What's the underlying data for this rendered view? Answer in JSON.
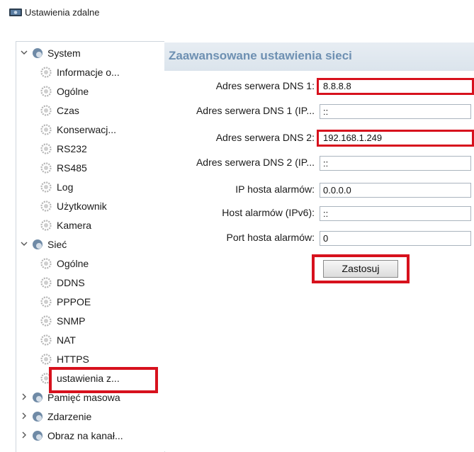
{
  "window": {
    "title": "Ustawienia zdalne",
    "icon": "device-icon"
  },
  "tree": {
    "items": [
      {
        "label": "System",
        "level": 0,
        "expanded": true
      },
      {
        "label": "Informacje o...",
        "level": 1
      },
      {
        "label": "Ogólne",
        "level": 1
      },
      {
        "label": "Czas",
        "level": 1
      },
      {
        "label": "Konserwacj...",
        "level": 1
      },
      {
        "label": "RS232",
        "level": 1
      },
      {
        "label": "RS485",
        "level": 1
      },
      {
        "label": "Log",
        "level": 1
      },
      {
        "label": "Użytkownik",
        "level": 1
      },
      {
        "label": "Kamera",
        "level": 1
      },
      {
        "label": "Sieć",
        "level": 0,
        "expanded": true
      },
      {
        "label": "Ogólne",
        "level": 1
      },
      {
        "label": "DDNS",
        "level": 1
      },
      {
        "label": "PPPOE",
        "level": 1
      },
      {
        "label": "SNMP",
        "level": 1
      },
      {
        "label": "NAT",
        "level": 1
      },
      {
        "label": "HTTPS",
        "level": 1
      },
      {
        "label": "ustawienia z...",
        "level": 1,
        "selected": true
      },
      {
        "label": "Pamięć masowa",
        "level": 0,
        "expanded": false
      },
      {
        "label": "Zdarzenie",
        "level": 0,
        "expanded": false
      },
      {
        "label": "Obraz na kanał...",
        "level": 0,
        "expanded": false
      }
    ]
  },
  "panel": {
    "title": "Zaawansowane ustawienia sieci",
    "fields": [
      {
        "label": "Adres serwera DNS 1:",
        "value": "8.8.8.8",
        "highlighted": true
      },
      {
        "label": "Adres serwera DNS 1 (IP...",
        "value": "::",
        "highlighted": false
      },
      {
        "label": "Adres serwera DNS 2:",
        "value": "192.168.1.249",
        "highlighted": true
      },
      {
        "label": "Adres serwera DNS 2 (IP...",
        "value": "::",
        "highlighted": false
      },
      {
        "label": "IP hosta alarmów:",
        "value": "0.0.0.0",
        "highlighted": false
      },
      {
        "label": "Host alarmów (IPv6):",
        "value": "::",
        "highlighted": false
      },
      {
        "label": "Port hosta alarmów:",
        "value": "0",
        "highlighted": false
      }
    ],
    "apply_label": "Zastosuj"
  },
  "colors": {
    "highlight": "#d7111d",
    "header_text": "#6e90b2"
  }
}
